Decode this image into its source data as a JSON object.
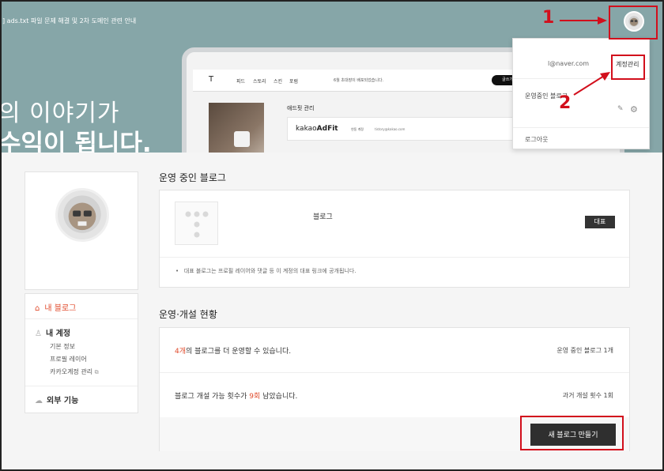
{
  "banner": {
    "notice": "] ads.txt 파일 문제 해결 및 2차 도메인 관련 안내",
    "line1": "의 이야기가",
    "line2": "수익이 됩니다."
  },
  "mockup": {
    "logo": "T",
    "menu": [
      "피드",
      "스토리",
      "스킨",
      "포럼"
    ],
    "message": "6월 초대장이 배포되었습니다.",
    "button": "글쓰기",
    "section_title": "애드핏 관리",
    "brand_prefix": "kakao",
    "brand_suffix": "AdFit",
    "account_label": "연동 계정",
    "account_email": "tistory@kakao.com"
  },
  "dropdown": {
    "email": "l@naver.com",
    "manage": "계정관리",
    "running": "운영중인 블로그",
    "logout": "로그아웃"
  },
  "annotations": [
    "1",
    "2"
  ],
  "sidebar": {
    "my_blog": "내 블로그",
    "my_account": "내 계정",
    "sub_items": [
      "기본 정보",
      "프로필 레이어",
      "카카오계정 관리"
    ],
    "external": "외부 기능"
  },
  "main": {
    "running_title": "운영 중인 블로그",
    "blog_name": "블로그",
    "rep_badge": "대표",
    "note": "대표 블로그는 프로필 레이어와 댓글 등 이 계정의 대표 링크에 공개됩니다.",
    "status_title": "운영·개설 현황",
    "row1_count": "4개",
    "row1_text": "의 블로그를 더 운영할 수 있습니다.",
    "row1_right": "운영 중인 블로그 1개",
    "row2_prefix": "블로그 개설 가능 횟수가 ",
    "row2_count": "9회",
    "row2_suffix": " 남았습니다.",
    "row2_right": "과거 개설 횟수 1회",
    "new_blog_button": "새 블로그 만들기"
  },
  "colors": {
    "accent": "#e04a2b",
    "annotation": "#d20f1c",
    "banner": "#86a6a8"
  }
}
